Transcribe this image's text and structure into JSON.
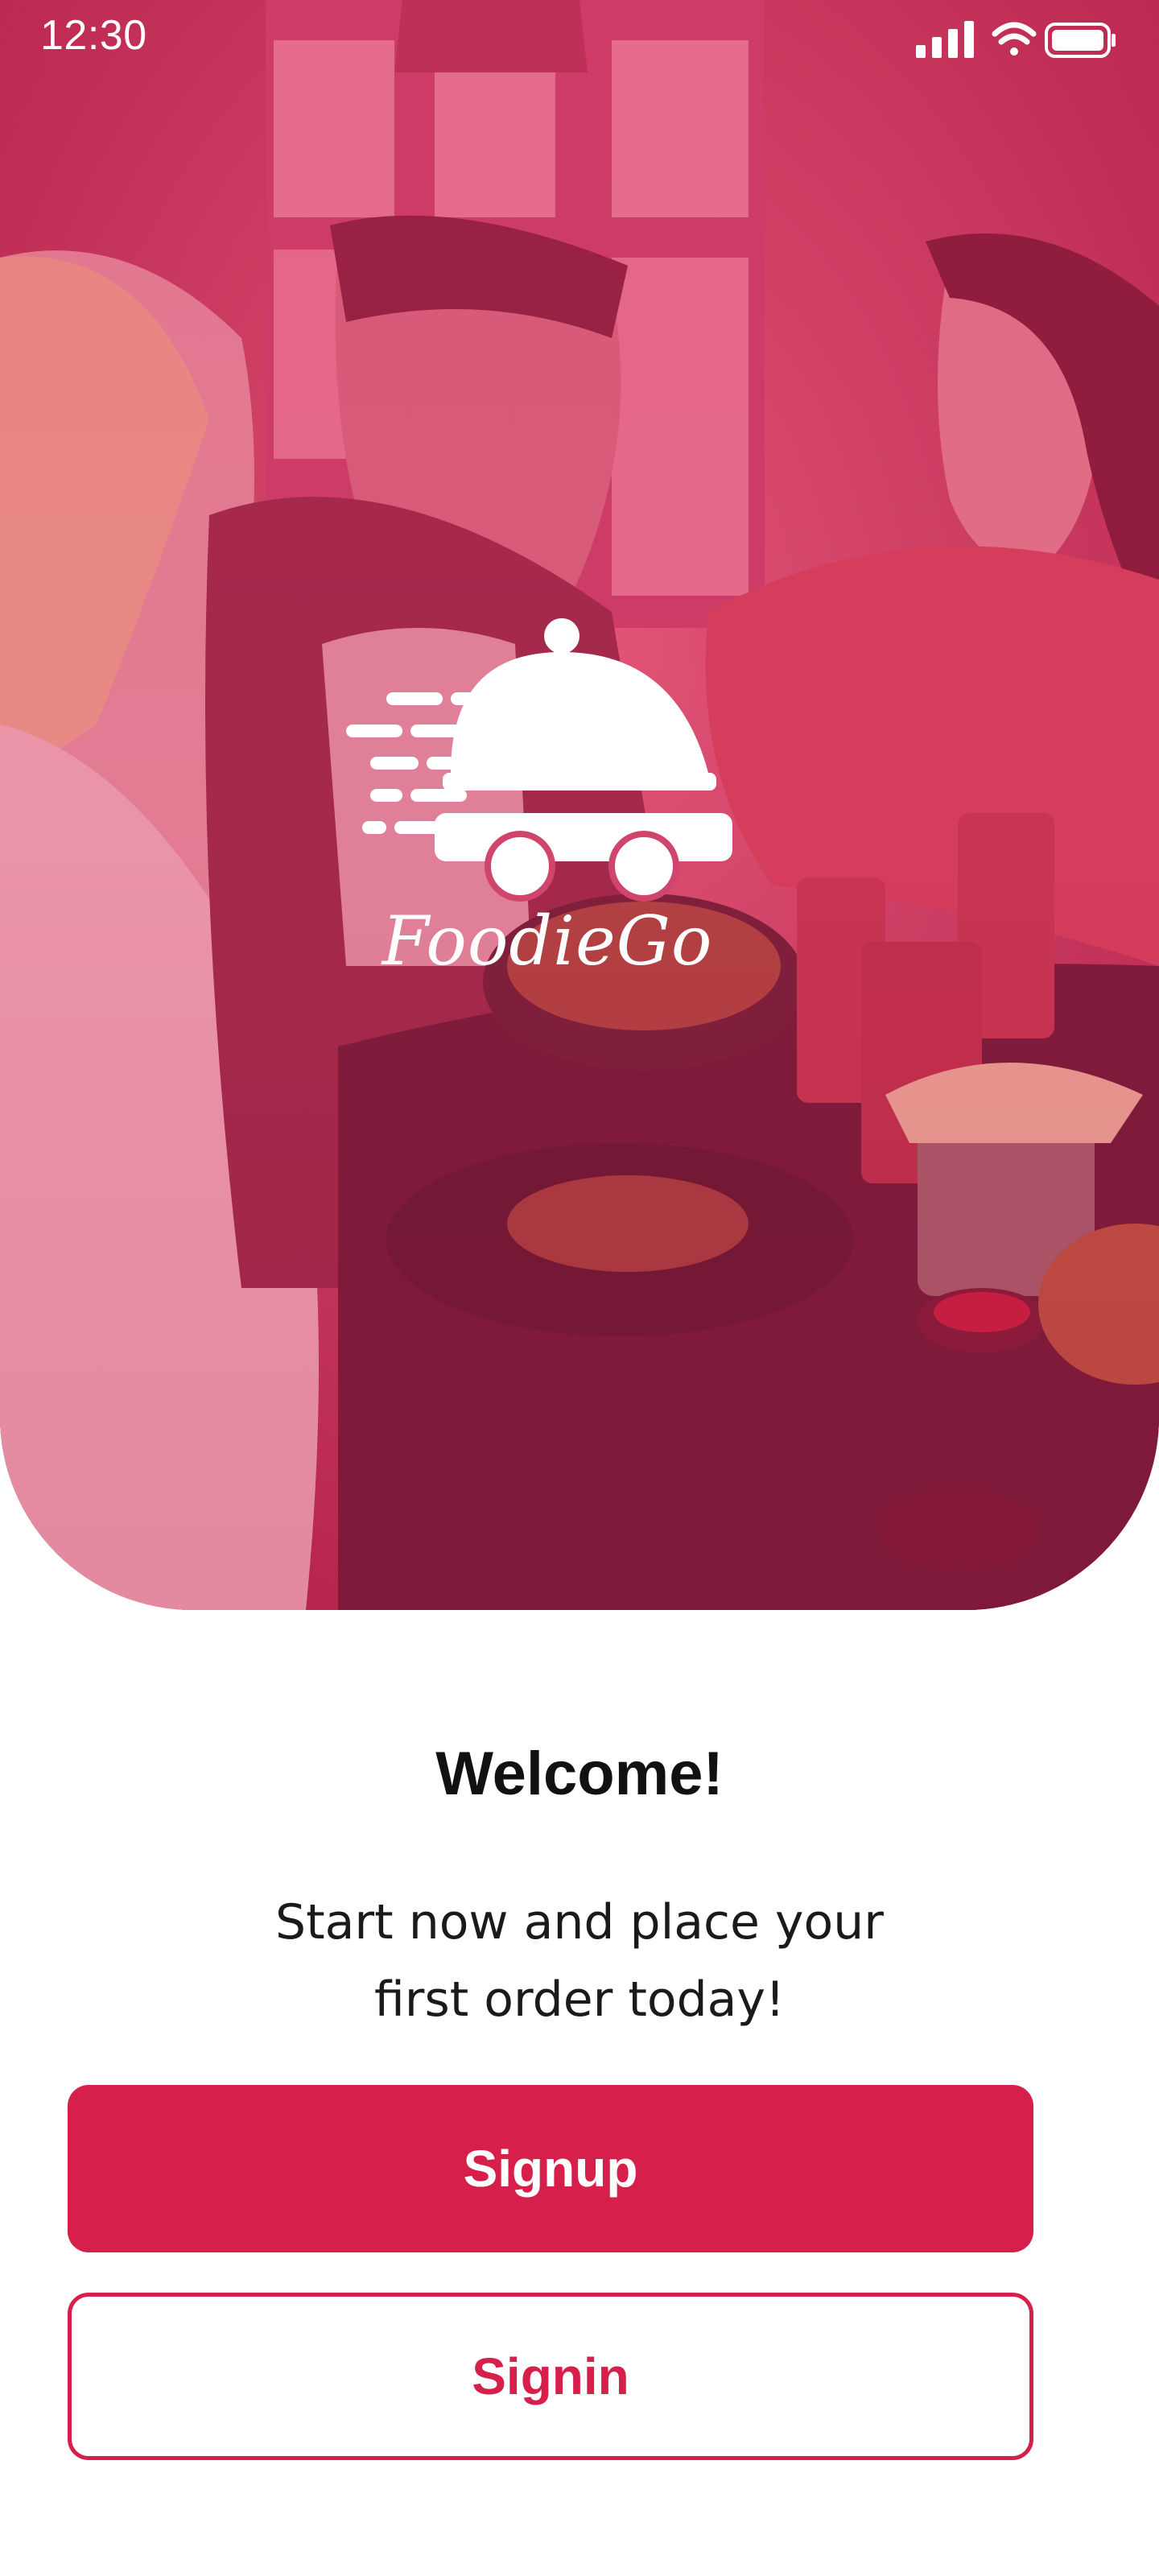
{
  "status_bar": {
    "time": "12:30",
    "icons": [
      "signal-icon",
      "wifi-icon",
      "battery-icon"
    ]
  },
  "brand": {
    "name": "FoodieGo",
    "logo_icon": "food-delivery-cart-icon",
    "accent_color": "#d61f4b"
  },
  "hero": {
    "image": "friends-dining-photo"
  },
  "content": {
    "title": "Welcome!",
    "subtitle_line1": "Start now and place your",
    "subtitle_line2": "first order today!"
  },
  "actions": {
    "signup_label": "Signup",
    "signin_label": "Signin"
  }
}
